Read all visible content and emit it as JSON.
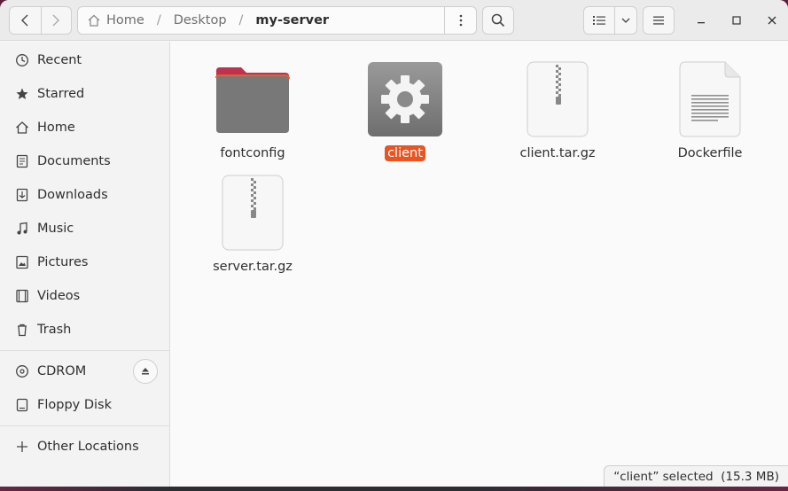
{
  "header": {
    "path": {
      "home": "Home",
      "crumb1": "Desktop",
      "current": "my-server"
    }
  },
  "sidebar": {
    "places": [
      {
        "label": "Recent",
        "icon": "clock-icon"
      },
      {
        "label": "Starred",
        "icon": "star-icon"
      },
      {
        "label": "Home",
        "icon": "home-icon"
      },
      {
        "label": "Documents",
        "icon": "document-icon"
      },
      {
        "label": "Downloads",
        "icon": "download-icon"
      },
      {
        "label": "Music",
        "icon": "music-icon"
      },
      {
        "label": "Pictures",
        "icon": "picture-icon"
      },
      {
        "label": "Videos",
        "icon": "video-icon"
      },
      {
        "label": "Trash",
        "icon": "trash-icon"
      }
    ],
    "devices": [
      {
        "label": "CDROM",
        "icon": "disc-icon"
      },
      {
        "label": "Floppy Disk",
        "icon": "drive-icon"
      }
    ],
    "other": {
      "label": "Other Locations",
      "icon": "plus-icon"
    }
  },
  "files": [
    {
      "name": "fontconfig",
      "type": "folder"
    },
    {
      "name": "client",
      "type": "executable",
      "selected": true
    },
    {
      "name": "client.tar.gz",
      "type": "archive"
    },
    {
      "name": "Dockerfile",
      "type": "text"
    },
    {
      "name": "server.tar.gz",
      "type": "archive"
    }
  ],
  "status": {
    "text": "“client” selected  (15.3 MB)"
  },
  "colors": {
    "accent": "#e95420",
    "folder": "#7a7a7a",
    "folder_tab": "#c0304f"
  }
}
